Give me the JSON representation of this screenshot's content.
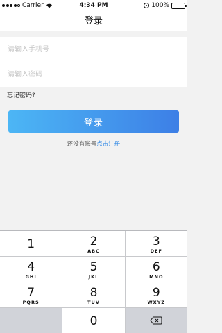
{
  "status_bar": {
    "carrier": "Carrier",
    "time": "4:34 PM",
    "battery": "100%"
  },
  "nav": {
    "title": "登录"
  },
  "form": {
    "phone_placeholder": "请输入手机号",
    "password_placeholder": "请输入密码",
    "forgot_label": "忘记密码?",
    "login_label": "登录",
    "no_account_text": "还没有账号",
    "register_link": "点击注册"
  },
  "colors": {
    "button_gradient_start": "#4cb6f5",
    "button_gradient_end": "#3d7fe6",
    "link": "#3a8ee6"
  },
  "keyboard": {
    "keys": [
      {
        "num": "1",
        "letters": ""
      },
      {
        "num": "2",
        "letters": "ABC"
      },
      {
        "num": "3",
        "letters": "DEF"
      },
      {
        "num": "4",
        "letters": "GHI"
      },
      {
        "num": "5",
        "letters": "JKL"
      },
      {
        "num": "6",
        "letters": "MNO"
      },
      {
        "num": "7",
        "letters": "PQRS"
      },
      {
        "num": "8",
        "letters": "TUV"
      },
      {
        "num": "9",
        "letters": "WXYZ"
      },
      {
        "num": "0",
        "letters": ""
      }
    ],
    "delete_icon": "backspace-icon"
  }
}
